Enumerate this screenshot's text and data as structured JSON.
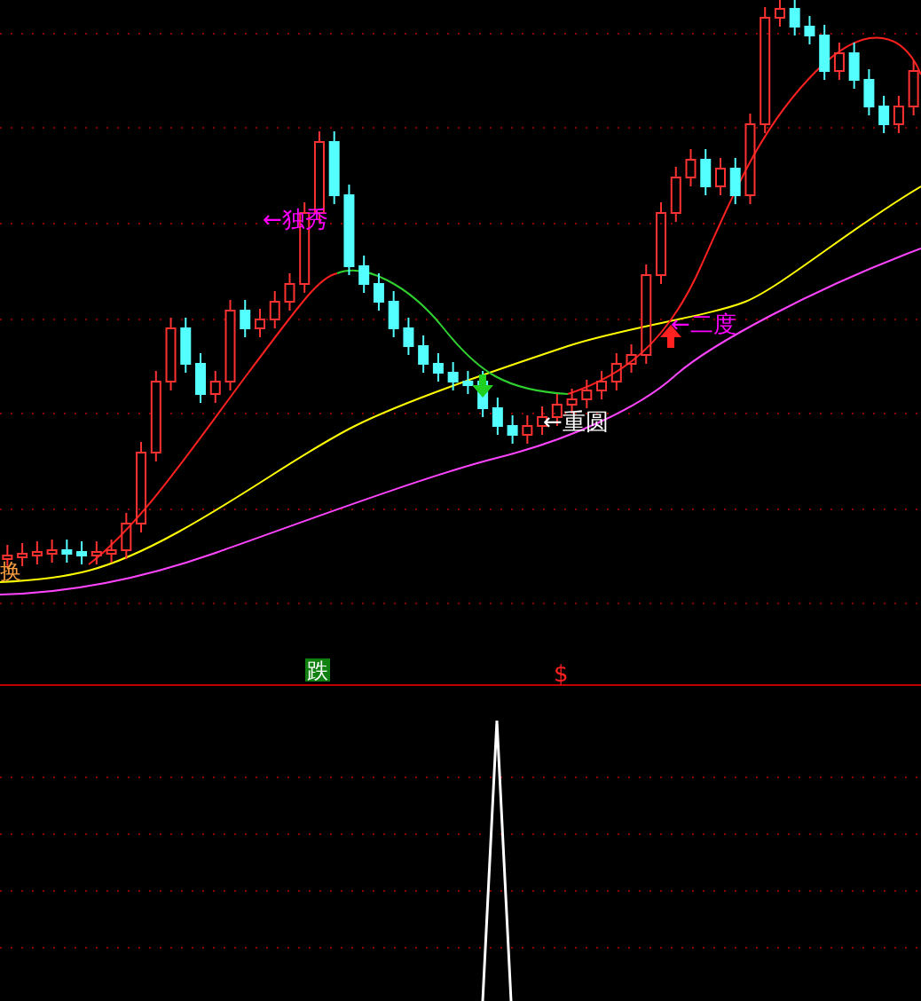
{
  "price_chart": {
    "annotations": [
      {
        "text": "←独秀",
        "color": "#ff00ff"
      },
      {
        "text": "←二度",
        "color": "#ff00ff"
      },
      {
        "text": "←重圆",
        "color": "#ffffff"
      }
    ],
    "edge_label": "换"
  },
  "signal_bar": {
    "markers": [
      {
        "kind": "badge",
        "text": "跌"
      },
      {
        "kind": "mark",
        "text": "$"
      }
    ]
  }
}
